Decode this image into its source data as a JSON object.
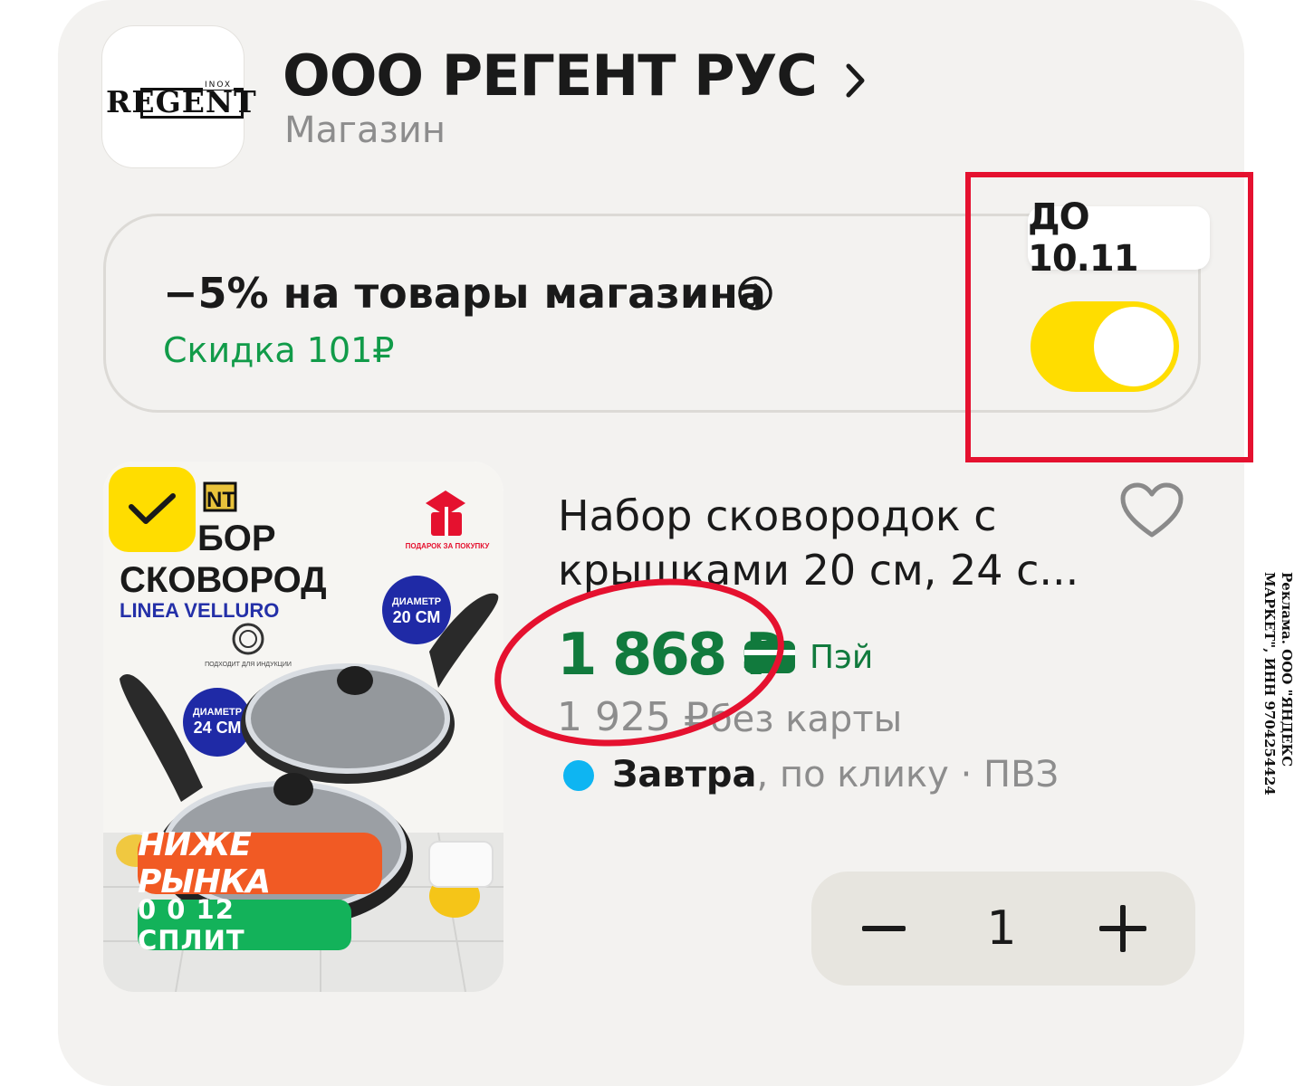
{
  "shop": {
    "logo_text": "REGENT",
    "logo_sub": "INOX",
    "name": "ООО РЕГЕНТ РУС",
    "type": "Магазин"
  },
  "promo": {
    "title": "−5% на товары магазина",
    "discount": "Скидка 101₽",
    "deadline": "ДО 10.11",
    "toggle_on": true,
    "toggle_color": "#ffdd00"
  },
  "product": {
    "image_texts": {
      "brand": "NT",
      "line1": "БОР",
      "line2": "СКОВОРОД",
      "line3": "LINEA VELLURO",
      "induction": "ПОДХОДИТ ДЛЯ ИНДУКЦИИ",
      "gift": "ПОДАРОК ЗА ПОКУПКУ",
      "diam1_label": "ДИАМЕТР",
      "diam1_value": "20 СМ",
      "diam2_label": "ДИАМЕТР",
      "diam2_value": "24 СМ"
    },
    "badge_primary": "НИЖЕ РЫНКА",
    "badge_split": "0 0 12 СПЛИТ",
    "title_line1": "Набор сковородок с",
    "title_line2": "крышками 20 см, 24 с...",
    "price": "1 868 ₽",
    "pay_label": "Пэй",
    "old_price": "1 925 ₽",
    "no_card": "без карты",
    "delivery_day": "Завтра",
    "delivery_rest": ", по клику · ПВЗ",
    "quantity": "1",
    "selected": true
  },
  "ad_disclaimer": "Реклама. ООО \"ЯНДЕКС МАРКЕТ\", ИНН 9704254424",
  "colors": {
    "accent_yellow": "#ffdd00",
    "price_green": "#117a3d",
    "discount_green": "#119b49",
    "annotation_red": "#e5112f"
  }
}
